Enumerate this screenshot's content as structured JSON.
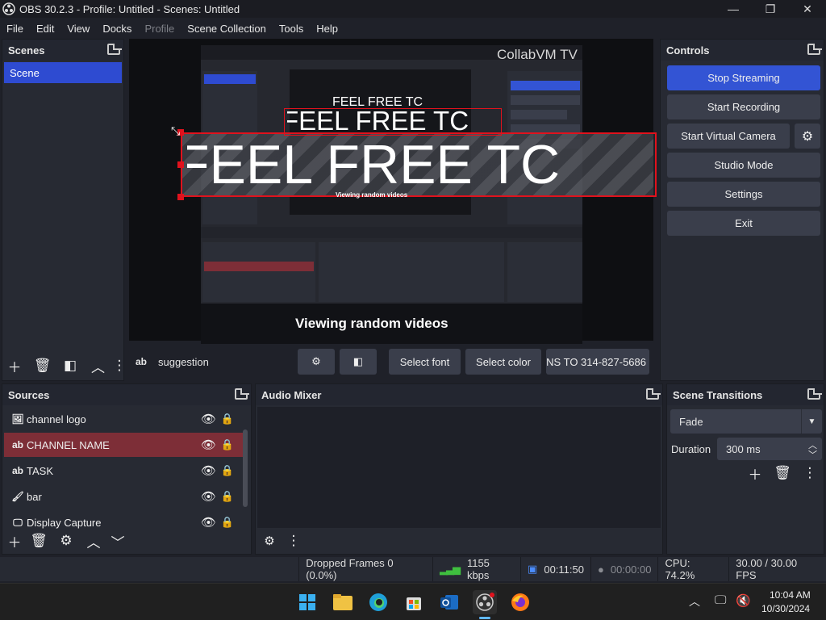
{
  "window": {
    "title": "OBS 30.2.3 - Profile: Untitled - Scenes: Untitled",
    "minimize": "—",
    "maximize": "❐",
    "close": "✕"
  },
  "menu": [
    "File",
    "Edit",
    "View",
    "Docks",
    "Profile",
    "Scene Collection",
    "Tools",
    "Help"
  ],
  "scenes": {
    "title": "Scenes",
    "items": [
      "Scene"
    ]
  },
  "preview": {
    "watermark": "CollabVM TV",
    "big_text": "FEEL FREE TC",
    "mid_text": "FEEL FREE TC",
    "small_text": "FEEL FREE TC",
    "bottom_caption": "Viewing random videos",
    "inner_caption": "Viewing random videos"
  },
  "source_toolbar": {
    "source_type_icon": "ab",
    "source_name": "suggestion",
    "select_font": "Select font",
    "select_color": "Select color",
    "text_value": "NS TO 314-827-5686"
  },
  "controls": {
    "title": "Controls",
    "stop_streaming": "Stop Streaming",
    "start_recording": "Start Recording",
    "start_virtual_camera": "Start Virtual Camera",
    "studio_mode": "Studio Mode",
    "settings": "Settings",
    "exit": "Exit"
  },
  "sources": {
    "title": "Sources",
    "items": [
      {
        "icon": "image-icon",
        "glyph": "🖼",
        "name": "channel logo"
      },
      {
        "icon": "text-icon",
        "glyph": "ab",
        "name": "CHANNEL NAME"
      },
      {
        "icon": "text-icon",
        "glyph": "ab",
        "name": "TASK"
      },
      {
        "icon": "brush-icon",
        "glyph": "🖌",
        "name": "bar"
      },
      {
        "icon": "monitor-icon",
        "glyph": "🖵",
        "name": "Display Capture"
      }
    ]
  },
  "audio_mixer": {
    "title": "Audio Mixer"
  },
  "transitions": {
    "title": "Scene Transitions",
    "selected": "Fade",
    "duration_label": "Duration",
    "duration_value": "300 ms"
  },
  "status": {
    "dropped_frames": "Dropped Frames 0 (0.0%)",
    "bitrate": "1155 kbps",
    "stream_time": "00:11:50",
    "record_time": "00:00:00",
    "cpu": "CPU: 74.2%",
    "fps": "30.00 / 30.00 FPS"
  },
  "taskbar": {
    "time": "10:04 AM",
    "date": "10/30/2024"
  },
  "colors": {
    "accent": "#3354d4",
    "selected_source": "#7d2e37",
    "red_outline": "#e0121d"
  }
}
